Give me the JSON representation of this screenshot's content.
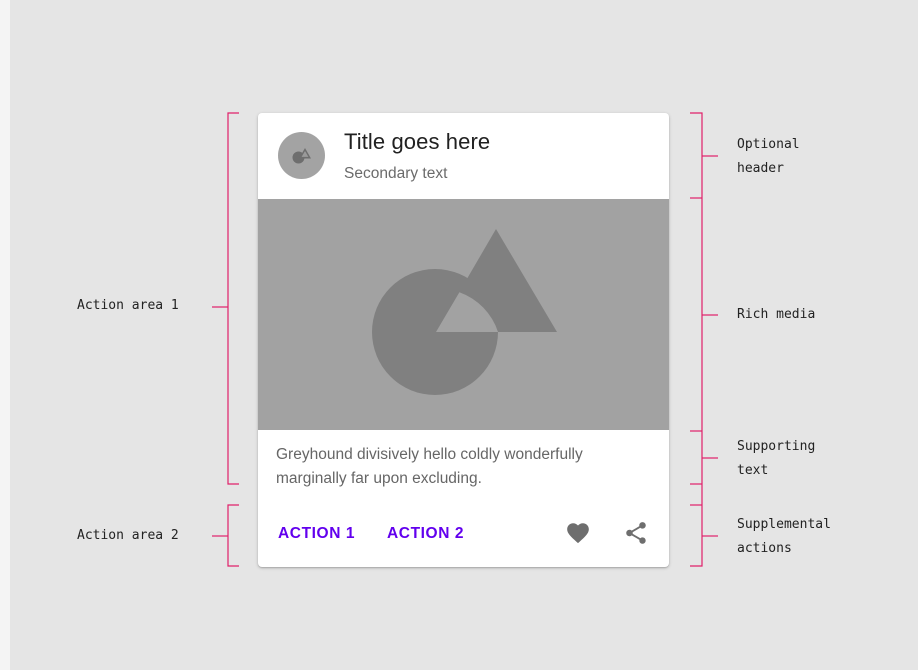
{
  "card": {
    "title": "Title goes here",
    "secondary_text": "Secondary text",
    "supporting_text": "Greyhound divisively hello coldly wonderfully marginally far upon excluding.",
    "actions": [
      "ACTION 1",
      "ACTION 2"
    ],
    "icons": [
      "favorite-icon",
      "share-icon"
    ]
  },
  "annotations": {
    "left": [
      "Action area 1",
      "Action area 2"
    ],
    "right": [
      [
        "Optional",
        "header"
      ],
      [
        "Rich media"
      ],
      [
        "Supporting",
        "text"
      ],
      [
        "Supplemental",
        "actions"
      ]
    ]
  },
  "colors": {
    "background": "#e5e5e5",
    "bracket": "#e0206a",
    "action_text": "#6200ee",
    "media": "#a2a2a2",
    "shape_dark": "#808080",
    "icon": "#6e6e6e"
  }
}
